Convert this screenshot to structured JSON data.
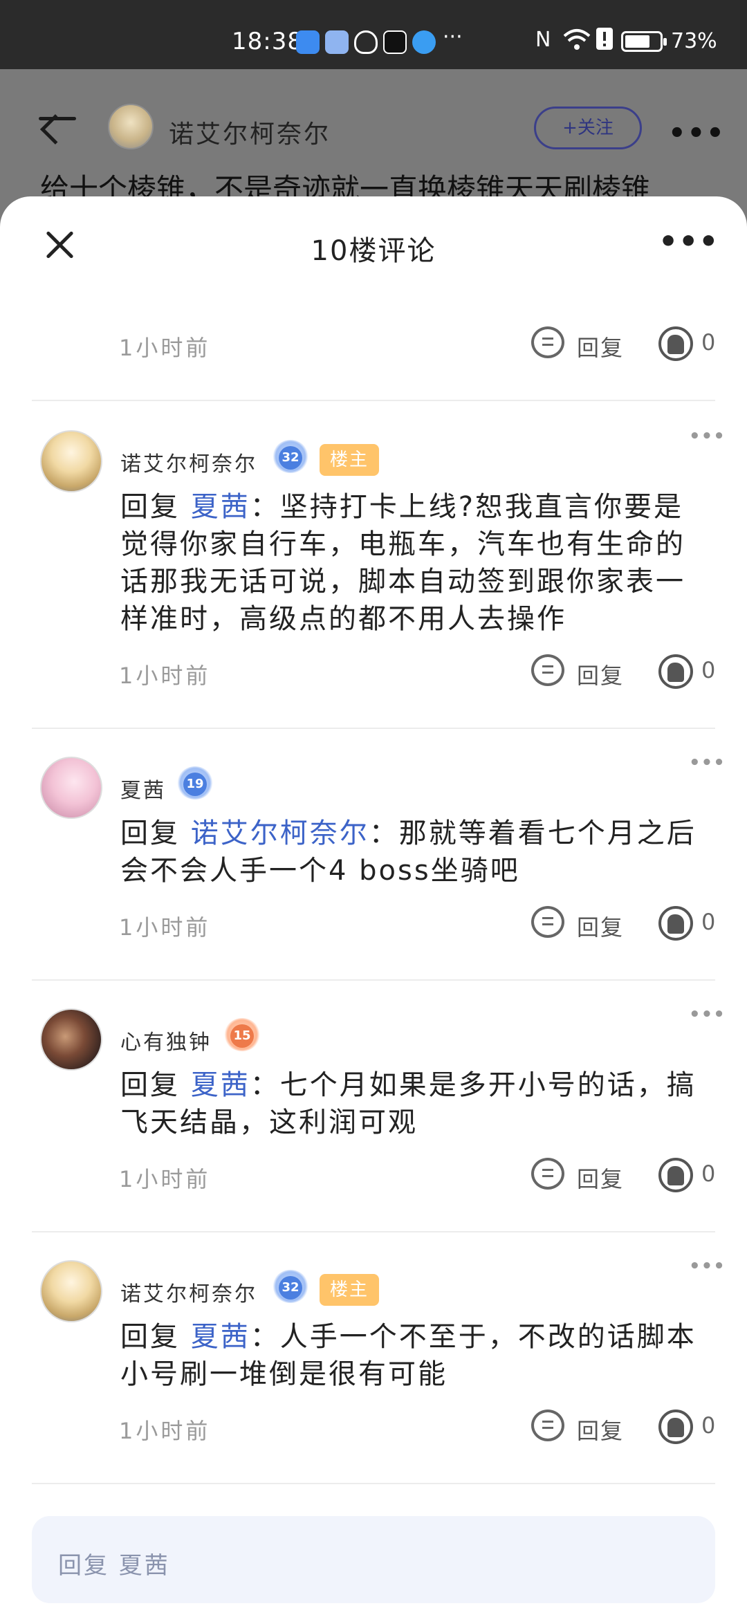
{
  "status_bar": {
    "time": "18:38",
    "more_icon": "···",
    "battery_percent": "73%",
    "battery_level": 0.73
  },
  "background_page": {
    "author_name": "诺艾尔柯奈尔",
    "follow_label": "+关注",
    "post_title": "给十个棱锥，不是奇迹就一直换棱锥天天刷棱锥"
  },
  "sheet": {
    "title": "10楼评论",
    "reply_input_placeholder": "回复 夏茜"
  },
  "first_meta": {
    "time": "1小时前",
    "reply_label": "回复",
    "likes": "0"
  },
  "comments": [
    {
      "name": "诺艾尔柯奈尔",
      "level": "32",
      "level_color": "#4b7fe0",
      "owner_badge": "楼主",
      "reply_prefix": "回复 ",
      "reply_target": "夏茜",
      "text": "：坚持打卡上线?恕我直言你要是觉得你家自行车，电瓶车，汽车也有生命的话那我无话可说，脚本自动签到跟你家表一样准时，高级点的都不用人去操作",
      "time": "1小时前",
      "reply_label": "回复",
      "likes": "0"
    },
    {
      "name": "夏茜",
      "level": "19",
      "level_color": "#4b7fe0",
      "reply_prefix": "回复 ",
      "reply_target": "诺艾尔柯奈尔",
      "text": "：那就等着看七个月之后会不会人手一个4 boss坐骑吧",
      "time": "1小时前",
      "reply_label": "回复",
      "likes": "0"
    },
    {
      "name": "心有独钟",
      "level": "15",
      "level_color": "#ee7a4a",
      "reply_prefix": "回复 ",
      "reply_target": "夏茜",
      "text": "：七个月如果是多开小号的话，搞飞天结晶，这利润可观",
      "time": "1小时前",
      "reply_label": "回复",
      "likes": "0"
    },
    {
      "name": "诺艾尔柯奈尔",
      "level": "32",
      "level_color": "#4b7fe0",
      "owner_badge": "楼主",
      "reply_prefix": "回复 ",
      "reply_target": "夏茜",
      "text": "：人手一个不至于，不改的话脚本小号刷一堆倒是很有可能",
      "time": "1小时前",
      "reply_label": "回复",
      "likes": "0"
    }
  ]
}
